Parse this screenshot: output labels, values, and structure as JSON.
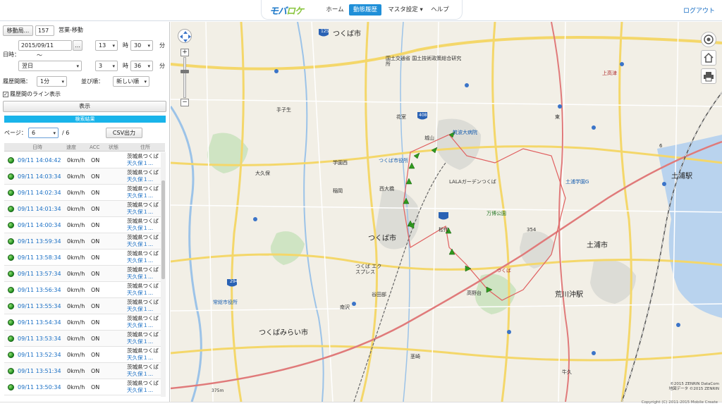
{
  "header": {
    "logo_main": "モバ",
    "logo_accent": "ロケ",
    "nav": [
      "ホーム",
      "動態履歴",
      "マスタ設定 ▾",
      "ヘルプ"
    ],
    "logout": "ログアウト"
  },
  "panel": {
    "vehicle_button": "移動局...",
    "vehicle_id": "157",
    "vehicle_name": "営業-移動",
    "datetime_label": "日時：",
    "start_date": "2015/09/11",
    "start_hour": "13",
    "start_min": "30",
    "hour_unit": "時",
    "min_unit": "分",
    "tilde": "～",
    "end_day": "翌日",
    "end_hour": "3",
    "end_min": "36",
    "interval_label": "履歴間隔：",
    "interval_value": "1分",
    "order_label": "並び順：",
    "order_value": "新しい順",
    "line_checkbox": "履歴間のライン表示",
    "show_button": "表示",
    "result_title": "検索結果",
    "page_label": "ページ：",
    "page_value": "6",
    "page_total": "/ 6",
    "csv_button": "CSV出力"
  },
  "table": {
    "headers": [
      "日時",
      "速度",
      "ACC",
      "状態",
      "住所"
    ],
    "rows": [
      {
        "time": "09/11 14:04:42",
        "speed": "0km/h",
        "acc": "ON",
        "addr1": "茨城県つくば",
        "addr2": "天久保１..."
      },
      {
        "time": "09/11 14:03:34",
        "speed": "0km/h",
        "acc": "ON",
        "addr1": "茨城県つくば",
        "addr2": "天久保１..."
      },
      {
        "time": "09/11 14:02:34",
        "speed": "0km/h",
        "acc": "ON",
        "addr1": "茨城県つくば",
        "addr2": "天久保１..."
      },
      {
        "time": "09/11 14:01:34",
        "speed": "0km/h",
        "acc": "ON",
        "addr1": "茨城県つくば",
        "addr2": "天久保１..."
      },
      {
        "time": "09/11 14:00:34",
        "speed": "0km/h",
        "acc": "ON",
        "addr1": "茨城県つくば",
        "addr2": "天久保１..."
      },
      {
        "time": "09/11 13:59:34",
        "speed": "0km/h",
        "acc": "ON",
        "addr1": "茨城県つくば",
        "addr2": "天久保１..."
      },
      {
        "time": "09/11 13:58:34",
        "speed": "0km/h",
        "acc": "ON",
        "addr1": "茨城県つくば",
        "addr2": "天久保１..."
      },
      {
        "time": "09/11 13:57:34",
        "speed": "0km/h",
        "acc": "ON",
        "addr1": "茨城県つくば",
        "addr2": "天久保１..."
      },
      {
        "time": "09/11 13:56:34",
        "speed": "0km/h",
        "acc": "ON",
        "addr1": "茨城県つくば",
        "addr2": "天久保１..."
      },
      {
        "time": "09/11 13:55:34",
        "speed": "0km/h",
        "acc": "ON",
        "addr1": "茨城県つくば",
        "addr2": "天久保１..."
      },
      {
        "time": "09/11 13:54:34",
        "speed": "0km/h",
        "acc": "ON",
        "addr1": "茨城県つくば",
        "addr2": "天久保１..."
      },
      {
        "time": "09/11 13:53:34",
        "speed": "0km/h",
        "acc": "ON",
        "addr1": "茨城県つくば",
        "addr2": "天久保１..."
      },
      {
        "time": "09/11 13:52:34",
        "speed": "0km/h",
        "acc": "ON",
        "addr1": "茨城県つくば",
        "addr2": "天久保１..."
      },
      {
        "time": "09/11 13:51:34",
        "speed": "0km/h",
        "acc": "ON",
        "addr1": "茨城県つくば",
        "addr2": "天久保１..."
      },
      {
        "time": "09/11 13:50:34",
        "speed": "0km/h",
        "acc": "ON",
        "addr1": "茨城県つくば",
        "addr2": "天久保１..."
      }
    ]
  },
  "map": {
    "labels": {
      "tsukuba_city": "つくば市",
      "tsukuba_city2": "つくば市",
      "tsukubamirai": "つくばみらい市",
      "tsuchiura": "土浦市",
      "tsuchiura_st": "土浦駅",
      "arakawaoki": "荒川沖駅",
      "tsukuba_office": "つくば市役所",
      "tsukuba_univ": "筑波大病院",
      "lala": "LALAガーデンつくば",
      "tsukuba_st": "つくば",
      "joso_office": "常総市役所",
      "tsuchiura_gakuen": "土浦学園G",
      "kenkyu": "国土交通省 国土技術政策総合研究所",
      "tsukuba_express": "つくば エクスプレス",
      "bankoku": "万博公園",
      "kitayawata": "高野台",
      "izumi": "城山",
      "hanamuro": "花室",
      "okubo": "大久保",
      "inaoka": "稲岡",
      "nishiohashi": "西大橋",
      "yatabe": "谷田部",
      "matsushiro": "松代",
      "kukizaki": "茎崎",
      "ushiku": "牛久",
      "minamizawa": "南沢",
      "hitachinokawa": "手子生",
      "gakuen": "学園西",
      "higashi": "東",
      "nikko": "上高津",
      "road408": "408",
      "road354": "354",
      "road6": "6",
      "road294": "294",
      "road125": "125"
    },
    "credit1": "©2015 ZENRIN DataCom",
    "credit2": "地図データ ©2015 ZENRIN",
    "copyright": "Copyright (C) 2011-2015 Mobile Create",
    "scale": "375m",
    "arrow_color": "#2f9a1e",
    "track_color": "#e06060"
  }
}
